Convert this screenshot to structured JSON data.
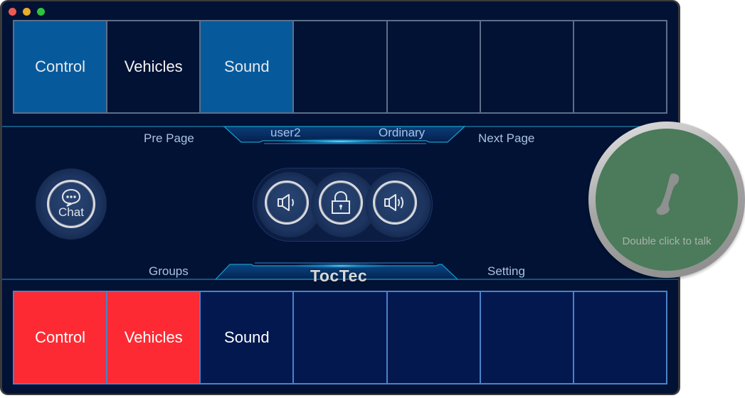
{
  "window": {
    "controls": [
      "close",
      "minimize",
      "zoom"
    ]
  },
  "top_grid": {
    "cells": [
      {
        "label": "Control",
        "active": true
      },
      {
        "label": "Vehicles",
        "active": false
      },
      {
        "label": "Sound",
        "active": true
      },
      {
        "label": "",
        "active": false
      },
      {
        "label": "",
        "active": false
      },
      {
        "label": "",
        "active": false
      },
      {
        "label": "",
        "active": false
      }
    ]
  },
  "top_bar": {
    "prev_page": "Pre Page",
    "user": "user2",
    "role": "Ordinary",
    "next_page": "Next Page"
  },
  "controls": {
    "chat_label": "Chat",
    "volume_down_icon": "speaker-low-icon",
    "lock_icon": "lock-icon",
    "volume_up_icon": "speaker-high-icon"
  },
  "talk_button": {
    "hint": "Double click to talk",
    "icon": "phone-handset-icon",
    "color": "#4b7b5a"
  },
  "bottom_bar": {
    "groups": "Groups",
    "brand": "TocTec",
    "setting": "Setting"
  },
  "bottom_grid": {
    "cells": [
      {
        "label": "Control",
        "alert": true
      },
      {
        "label": "Vehicles",
        "alert": true
      },
      {
        "label": "Sound",
        "alert": false
      },
      {
        "label": "",
        "alert": false
      },
      {
        "label": "",
        "alert": false
      },
      {
        "label": "",
        "alert": false
      },
      {
        "label": "",
        "alert": false
      }
    ]
  },
  "colors": {
    "background": "#011235",
    "active_blue": "#065a9c",
    "alert_red": "#fd2a33",
    "bottom_cell": "#02184f",
    "accent_cyan": "#1fa6e0"
  }
}
